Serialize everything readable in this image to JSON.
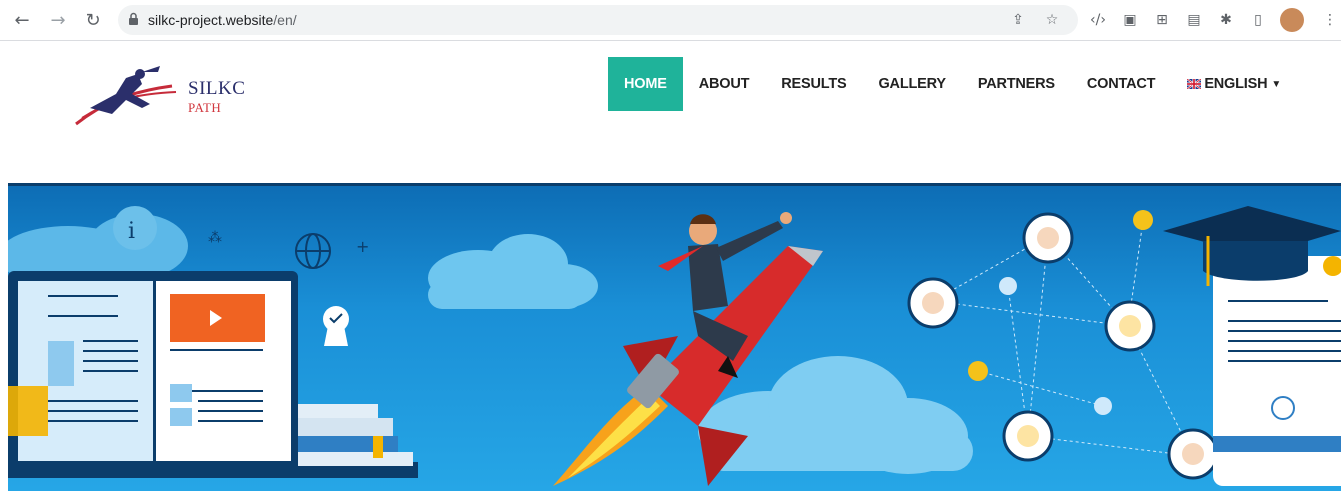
{
  "browser": {
    "url_host": "silkc-project.website",
    "url_path": "/en/",
    "icons": [
      "back-icon",
      "forward-icon",
      "reload-icon",
      "lock-icon",
      "share-icon",
      "star-icon",
      "code-icon",
      "extension-icon",
      "grid-icon",
      "screen-icon",
      "puzzle-icon",
      "sidepanel-icon",
      "profile-avatar",
      "menu-icon"
    ]
  },
  "logo": {
    "line1": "SILKC",
    "line2": "PATH"
  },
  "menu": {
    "items": [
      {
        "label": "HOME",
        "active": true
      },
      {
        "label": "ABOUT",
        "active": false
      },
      {
        "label": "RESULTS",
        "active": false
      },
      {
        "label": "GALLERY",
        "active": false
      },
      {
        "label": "PARTNERS",
        "active": false
      },
      {
        "label": "CONTACT",
        "active": false
      },
      {
        "label": "ENGLISH",
        "active": false
      }
    ]
  },
  "colors": {
    "accent": "#1fb39a",
    "hero_top": "#0d6db5",
    "hero_bottom": "#26a6e6",
    "rocket": "#d72b2b"
  }
}
